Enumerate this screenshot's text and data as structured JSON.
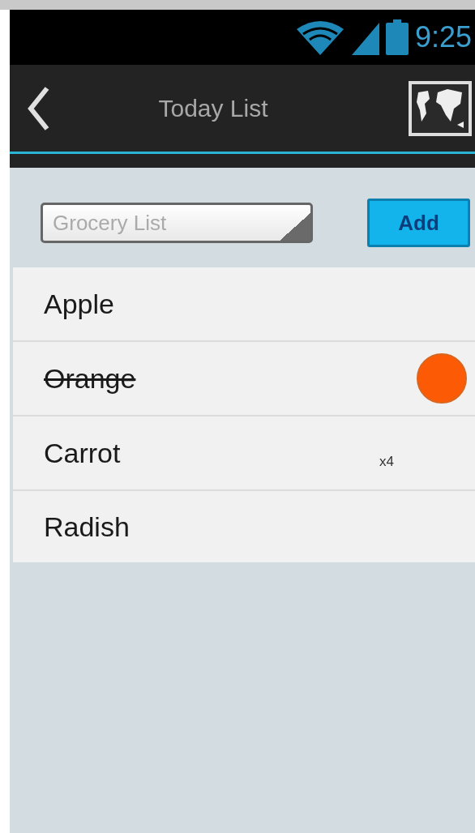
{
  "status_bar": {
    "time": "9:25"
  },
  "action_bar": {
    "title": "Today List"
  },
  "entry": {
    "placeholder": "Grocery List",
    "button": "Add"
  },
  "items": [
    {
      "label": "Apple",
      "crossed": false,
      "flagged": false
    },
    {
      "label": "Orange",
      "crossed": true,
      "flagged": true
    },
    {
      "label": "Carrot",
      "crossed": false,
      "flagged": false,
      "count": "x4"
    },
    {
      "label": "Radish",
      "crossed": false,
      "flagged": false
    }
  ]
}
